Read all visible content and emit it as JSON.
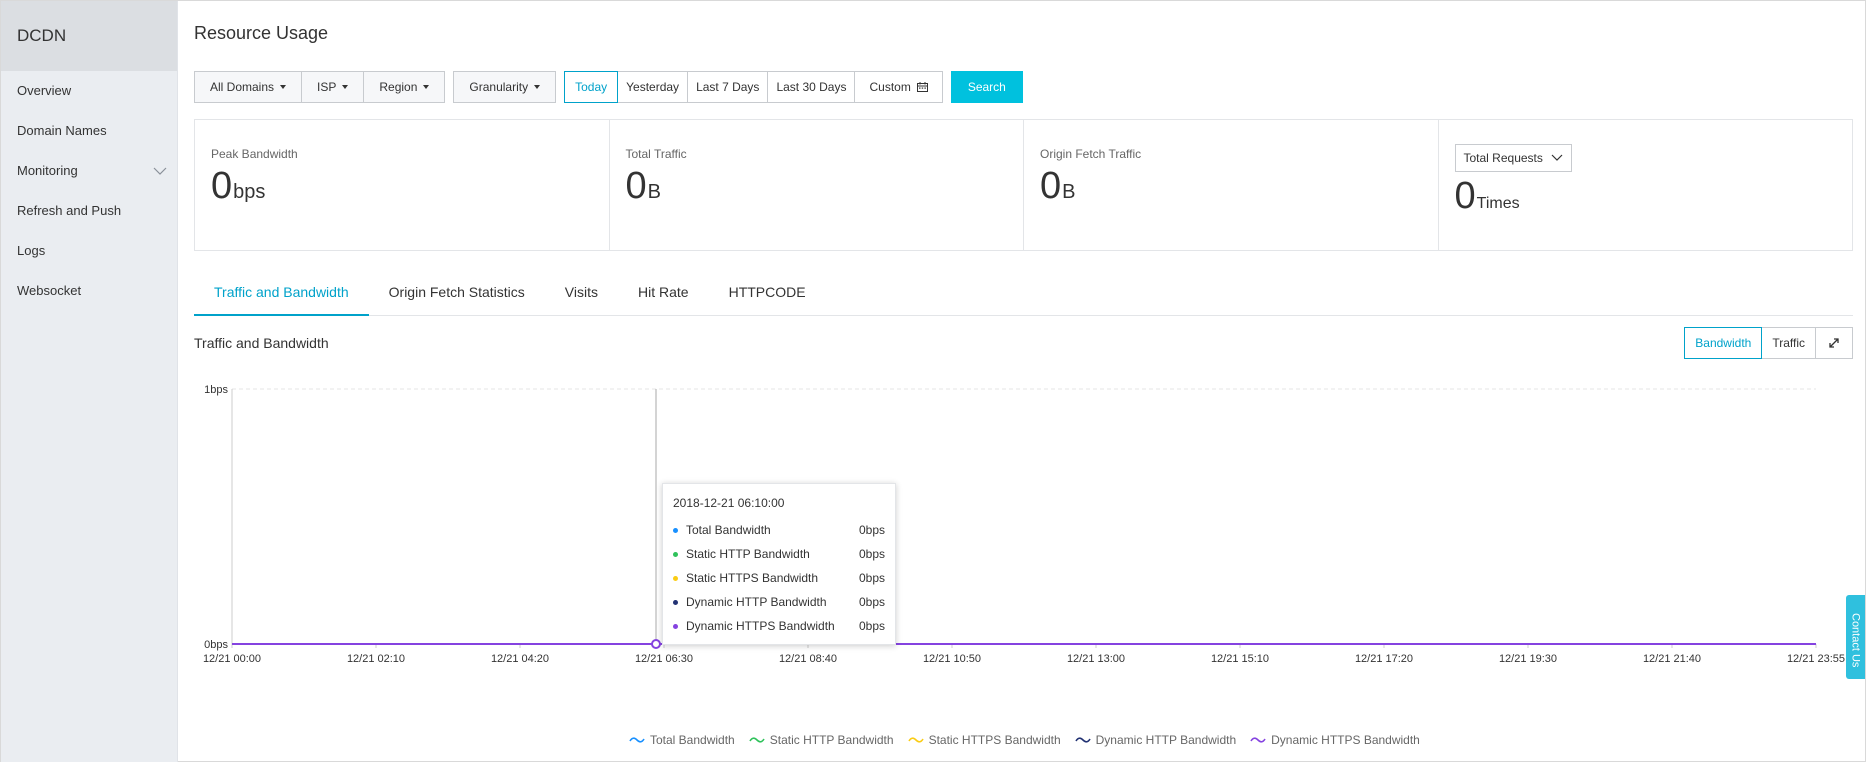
{
  "sidebar": {
    "brand": "DCDN",
    "items": [
      {
        "label": "Overview"
      },
      {
        "label": "Domain Names"
      },
      {
        "label": "Monitoring"
      },
      {
        "label": "Refresh and Push"
      },
      {
        "label": "Logs"
      },
      {
        "label": "Websocket"
      }
    ]
  },
  "page": {
    "title": "Resource Usage"
  },
  "filters": {
    "domains": "All Domains",
    "isp": "ISP",
    "region": "Region",
    "granularity": "Granularity",
    "ranges": [
      "Today",
      "Yesterday",
      "Last 7 Days",
      "Last 30 Days"
    ],
    "active_range": "Today",
    "custom": "Custom",
    "search": "Search"
  },
  "stats": {
    "peak_bandwidth": {
      "label": "Peak Bandwidth",
      "value": "0",
      "unit": "bps"
    },
    "total_traffic": {
      "label": "Total Traffic",
      "value": "0",
      "unit": "B"
    },
    "origin_fetch_traffic": {
      "label": "Origin Fetch Traffic",
      "value": "0",
      "unit": "B"
    },
    "total_requests": {
      "select": "Total Requests",
      "value": "0",
      "unit": "Times"
    }
  },
  "tabs": [
    {
      "label": "Traffic and Bandwidth",
      "active": true
    },
    {
      "label": "Origin Fetch Statistics"
    },
    {
      "label": "Visits"
    },
    {
      "label": "Hit Rate"
    },
    {
      "label": "HTTPCODE"
    }
  ],
  "section": {
    "title": "Traffic and Bandwidth",
    "toggle": {
      "bandwidth": "Bandwidth",
      "traffic": "Traffic",
      "active": "Bandwidth"
    }
  },
  "tooltip": {
    "title": "2018-12-21 06:10:00",
    "rows": [
      {
        "name": "Total Bandwidth",
        "value": "0bps",
        "color": "#1890ff"
      },
      {
        "name": "Static HTTP Bandwidth",
        "value": "0bps",
        "color": "#2fc25b"
      },
      {
        "name": "Static HTTPS Bandwidth",
        "value": "0bps",
        "color": "#facc14"
      },
      {
        "name": "Dynamic HTTP Bandwidth",
        "value": "0bps",
        "color": "#223273"
      },
      {
        "name": "Dynamic HTTPS Bandwidth",
        "value": "0bps",
        "color": "#8543e0"
      }
    ]
  },
  "chart_data": {
    "type": "line",
    "ylabel_ticks": [
      "0bps",
      "1bps"
    ],
    "ylim": [
      0,
      1
    ],
    "x_ticks": [
      "12/21 00:00",
      "12/21 02:10",
      "12/21 04:20",
      "12/21 06:30",
      "12/21 08:40",
      "12/21 10:50",
      "12/21 13:00",
      "12/21 15:10",
      "12/21 17:20",
      "12/21 19:30",
      "12/21 21:40",
      "12/21 23:55"
    ],
    "series": [
      {
        "name": "Total Bandwidth",
        "color": "#1890ff",
        "values": [
          0,
          0,
          0,
          0,
          0,
          0,
          0,
          0,
          0,
          0,
          0,
          0
        ]
      },
      {
        "name": "Static HTTP Bandwidth",
        "color": "#2fc25b",
        "values": [
          0,
          0,
          0,
          0,
          0,
          0,
          0,
          0,
          0,
          0,
          0,
          0
        ]
      },
      {
        "name": "Static HTTPS Bandwidth",
        "color": "#facc14",
        "values": [
          0,
          0,
          0,
          0,
          0,
          0,
          0,
          0,
          0,
          0,
          0,
          0
        ]
      },
      {
        "name": "Dynamic HTTP Bandwidth",
        "color": "#223273",
        "values": [
          0,
          0,
          0,
          0,
          0,
          0,
          0,
          0,
          0,
          0,
          0,
          0
        ]
      },
      {
        "name": "Dynamic HTTPS Bandwidth",
        "color": "#8543e0",
        "values": [
          0,
          0,
          0,
          0,
          0,
          0,
          0,
          0,
          0,
          0,
          0,
          0
        ]
      }
    ],
    "hover_x": "2018-12-21 06:10:00",
    "legend_position": "bottom"
  },
  "contact": "Contact Us",
  "icons": {
    "custom": "calendar-icon",
    "fullscreen": "expand-icon",
    "monitoring": "chevron-down-icon"
  }
}
